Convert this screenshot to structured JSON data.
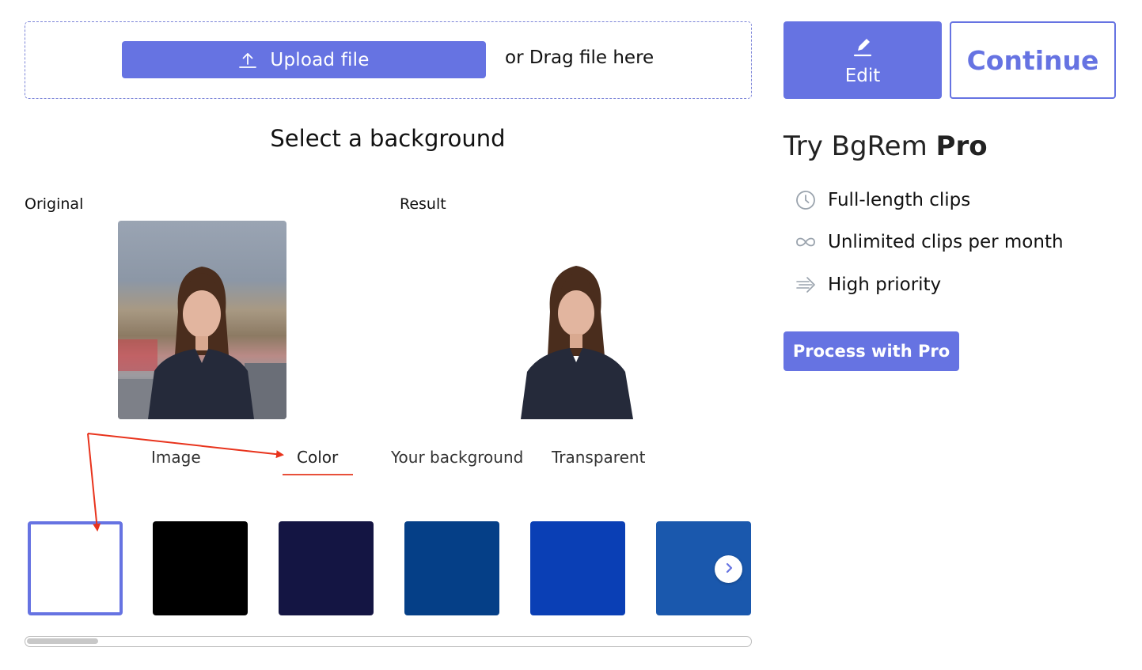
{
  "upload": {
    "button_label": "Upload file",
    "drag_text": "or Drag file here"
  },
  "actions": {
    "edit_label": "Edit",
    "continue_label": "Continue"
  },
  "main": {
    "title": "Select a background",
    "original_label": "Original",
    "result_label": "Result",
    "tabs": [
      {
        "label": "Image",
        "active": false
      },
      {
        "label": "Color",
        "active": true
      },
      {
        "label": "Your background",
        "active": false
      },
      {
        "label": "Transparent",
        "active": false
      }
    ],
    "swatches": [
      "#ffffff",
      "#000000",
      "#141543",
      "#053f87",
      "#0a3fb5",
      "#1a58ad"
    ],
    "selected_swatch": "#ffffff"
  },
  "pro": {
    "title_prefix": "Try BgRem ",
    "title_bold": "Pro",
    "features": [
      {
        "icon": "clock-icon",
        "label": "Full-length clips"
      },
      {
        "icon": "infinity-icon",
        "label": "Unlimited clips per month"
      },
      {
        "icon": "fast-arrow-icon",
        "label": "High priority"
      }
    ],
    "button_label": "Process with Pro"
  },
  "colors": {
    "accent": "#6673e2",
    "tab_underline": "#e8503a",
    "annotation": "#e8331c"
  }
}
